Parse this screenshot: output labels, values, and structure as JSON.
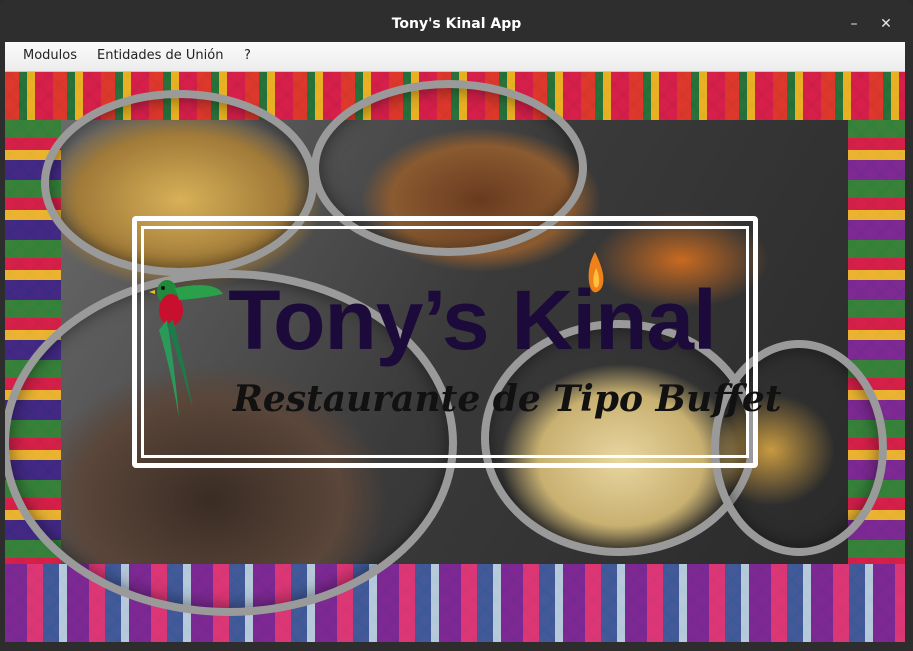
{
  "window": {
    "title": "Tony's Kinal App",
    "minimize_icon": "minimize-icon",
    "close_icon": "close-icon",
    "minimize_glyph": "–",
    "close_glyph": "✕"
  },
  "menubar": {
    "items": [
      {
        "label": "Modulos"
      },
      {
        "label": "Entidades de Unión"
      },
      {
        "label": "?"
      }
    ]
  },
  "banner": {
    "title": "Tony’s Kinal",
    "subtitle": "Restaurante de Tipo Buffet"
  },
  "colors": {
    "logo_text": "#1c0a3a",
    "frame": "#ffffff",
    "menubar_bg": "#f5f5f5",
    "titlebar_bg": "#2e2e2e"
  }
}
